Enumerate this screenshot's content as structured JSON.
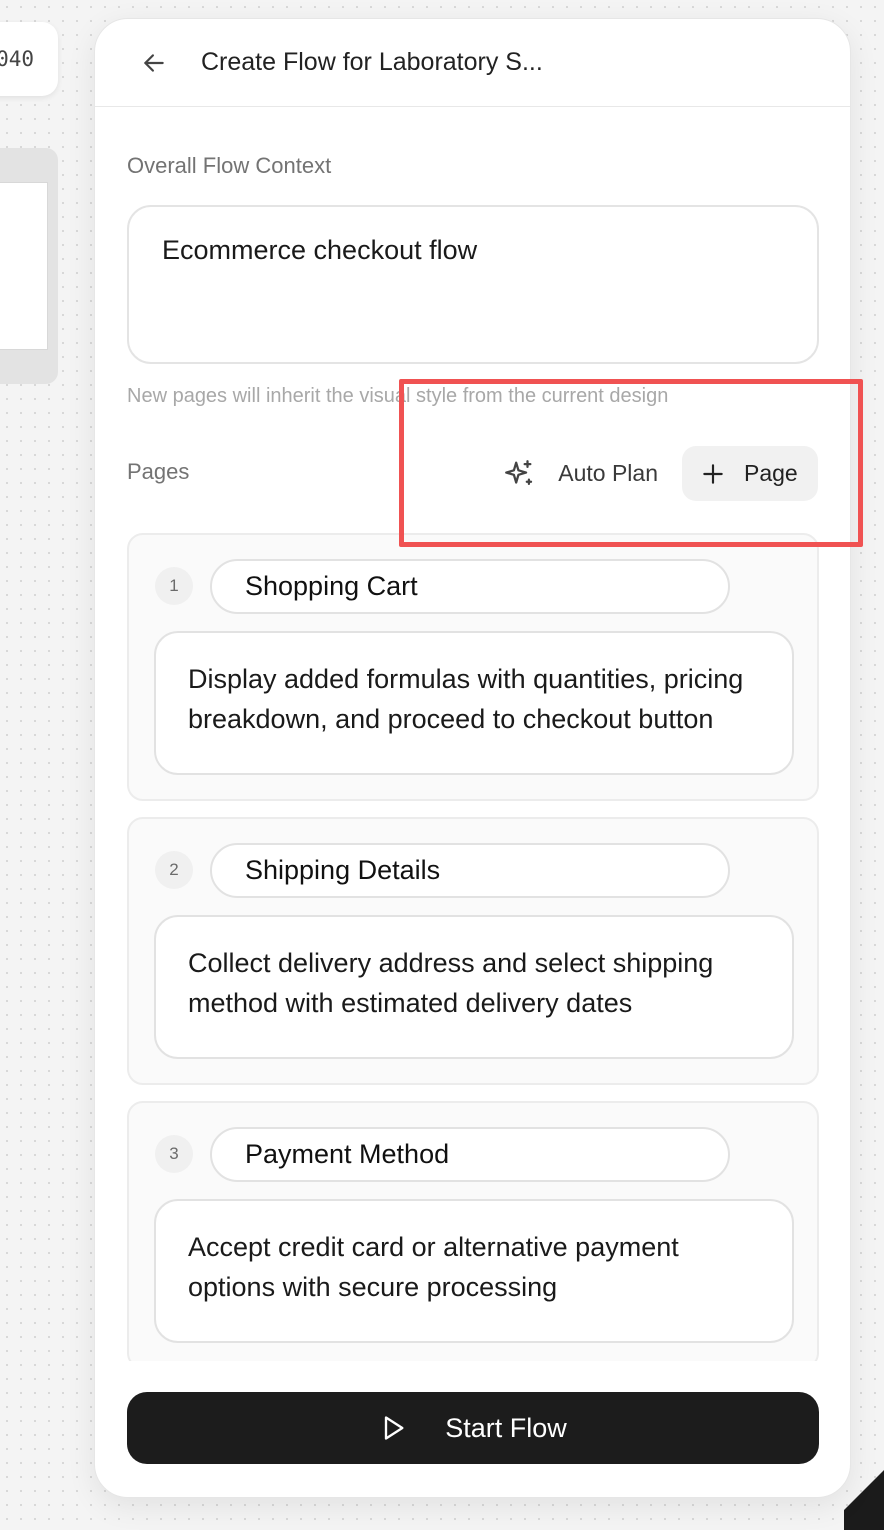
{
  "canvas": {
    "left_chip_text": "040"
  },
  "header": {
    "back_icon": "arrow-left-icon",
    "title": "Create Flow for Laboratory S..."
  },
  "context": {
    "label": "Overall Flow Context",
    "value": "Ecommerce checkout flow",
    "hint": "New pages will inherit the visual style from the current design"
  },
  "pages_section": {
    "label": "Pages",
    "auto_plan_icon": "sparkle-icon",
    "auto_plan_label": "Auto Plan",
    "add_page_icon": "plus-icon",
    "add_page_label": "Page"
  },
  "pages": [
    {
      "number": "1",
      "name": "Shopping Cart",
      "description": "Display added formulas with quantities, pricing breakdown, and proceed to checkout button"
    },
    {
      "number": "2",
      "name": "Shipping Details",
      "description": "Collect delivery address and select shipping method with estimated delivery dates"
    },
    {
      "number": "3",
      "name": "Payment Method",
      "description": "Accept credit card or alternative payment options with secure processing"
    }
  ],
  "footer": {
    "start_icon": "play-icon",
    "start_label": "Start Flow"
  },
  "colors": {
    "highlight": "#f05252",
    "primary_button": "#1c1c1c"
  }
}
